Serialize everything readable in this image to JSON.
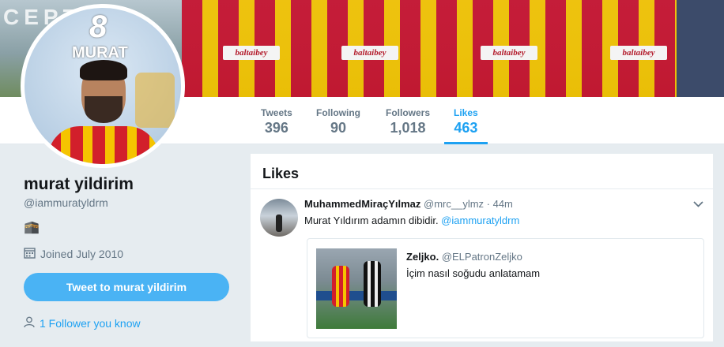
{
  "banner": {
    "letters": "CEPT",
    "sponsor_text": "baltaibey"
  },
  "avatar": {
    "number": "8",
    "name": "MURAT"
  },
  "nav": {
    "stats": [
      {
        "label": "Tweets",
        "value": "396"
      },
      {
        "label": "Following",
        "value": "90"
      },
      {
        "label": "Followers",
        "value": "1,018"
      },
      {
        "label": "Likes",
        "value": "463"
      }
    ],
    "active_index": 3
  },
  "profile": {
    "name": "murat yildirim",
    "handle": "@iammuratyldrm",
    "bio": "🕋",
    "joined": "Joined July 2010",
    "tweet_button": "Tweet to murat yildirim",
    "followers_you_know": "1 Follower you know"
  },
  "main": {
    "title": "Likes",
    "tweet": {
      "display_name": "MuhammedMiraçYılmaz",
      "meta": "@mrc__ylmz · 44m",
      "text": "Murat Yıldırım adamın dibidir. ",
      "mention": "@iammuratyldrm",
      "quote": {
        "display_name": "Zeljko.",
        "handle": "@ELPatronZeljko",
        "text": "İçim nasıl soğudu anlatamam"
      }
    }
  },
  "colors": {
    "accent": "#1da1f2",
    "button": "#4ab3f4",
    "muted": "#657786",
    "background": "#e6ecf0"
  }
}
